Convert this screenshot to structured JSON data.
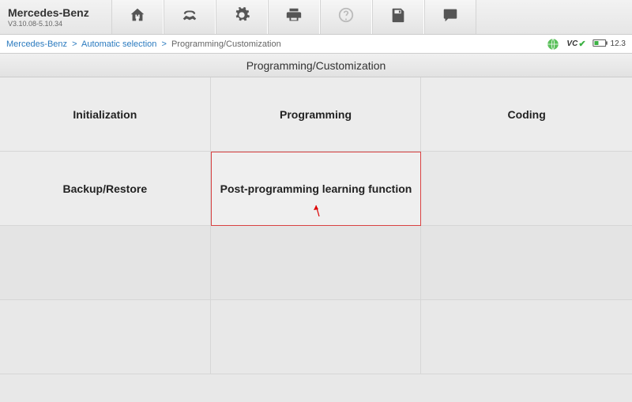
{
  "brand": {
    "name": "Mercedes-Benz",
    "version": "V3.10.08-5.10.34"
  },
  "breadcrumb": {
    "items": [
      "Mercedes-Benz",
      "Automatic selection"
    ],
    "current": "Programming/Customization"
  },
  "status": {
    "vc_label": "VC",
    "voltage": "12.3"
  },
  "section_title": "Programming/Customization",
  "grid": {
    "cells": [
      "Initialization",
      "Programming",
      "Coding",
      "Backup/Restore",
      "Post-programming learning function",
      "",
      "",
      "",
      ""
    ],
    "selected_index": 4
  }
}
